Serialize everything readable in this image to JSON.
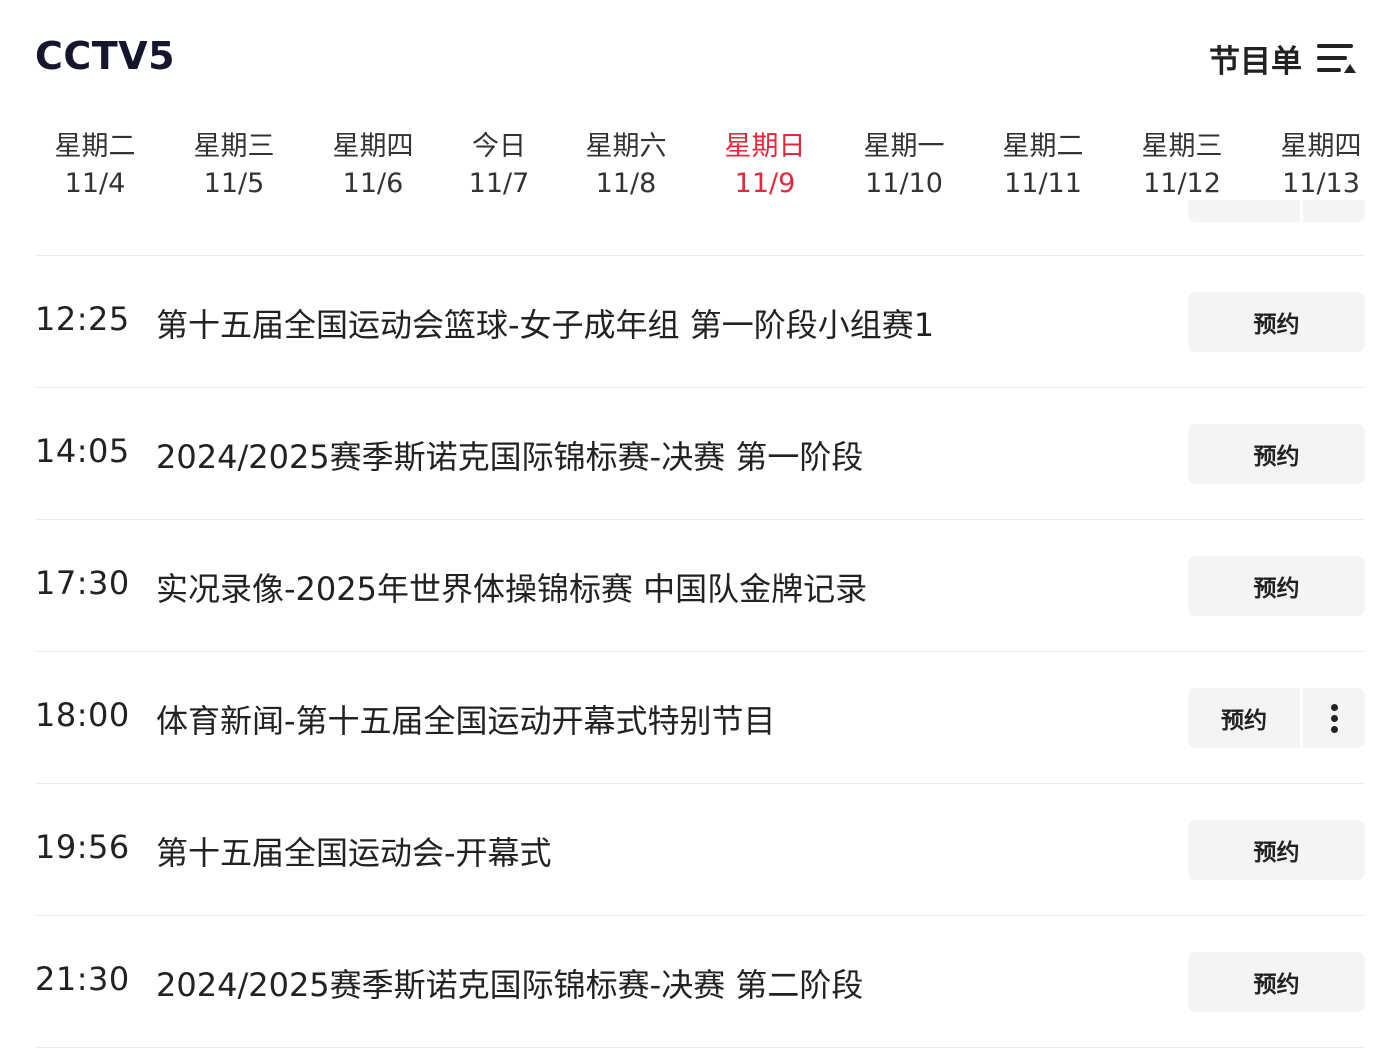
{
  "header": {
    "channel": "CCTV5",
    "schedule_label": "节目单",
    "menu_icon": "list-sort-icon"
  },
  "date_tabs": [
    {
      "weekday": "星期二",
      "date": "11/4",
      "active": false
    },
    {
      "weekday": "星期三",
      "date": "11/5",
      "active": false
    },
    {
      "weekday": "星期四",
      "date": "11/6",
      "active": false
    },
    {
      "weekday": "今日",
      "date": "11/7",
      "active": false
    },
    {
      "weekday": "星期六",
      "date": "11/8",
      "active": false
    },
    {
      "weekday": "星期日",
      "date": "11/9",
      "active": true
    },
    {
      "weekday": "星期一",
      "date": "11/10",
      "active": false
    },
    {
      "weekday": "星期二",
      "date": "11/11",
      "active": false
    },
    {
      "weekday": "星期三",
      "date": "11/12",
      "active": false
    },
    {
      "weekday": "星期四",
      "date": "11/13",
      "active": false
    }
  ],
  "active_color": "#e5283b",
  "programs": [
    {
      "time": "12:25",
      "title": "第十五届全国运动会篮球-女子成年组 第一阶段小组赛1",
      "button": "预约",
      "has_more": false
    },
    {
      "time": "14:05",
      "title": "2024/2025赛季斯诺克国际锦标赛-决赛 第一阶段",
      "button": "预约",
      "has_more": false
    },
    {
      "time": "17:30",
      "title": "实况录像-2025年世界体操锦标赛 中国队金牌记录",
      "button": "预约",
      "has_more": false
    },
    {
      "time": "18:00",
      "title": "体育新闻-第十五届全国运动开幕式特别节目",
      "button": "预约",
      "has_more": true
    },
    {
      "time": "19:56",
      "title": "第十五届全国运动会-开幕式",
      "button": "预约",
      "has_more": false
    },
    {
      "time": "21:30",
      "title": "2024/2025赛季斯诺克国际锦标赛-决赛 第二阶段",
      "button": "预约",
      "has_more": false
    }
  ]
}
